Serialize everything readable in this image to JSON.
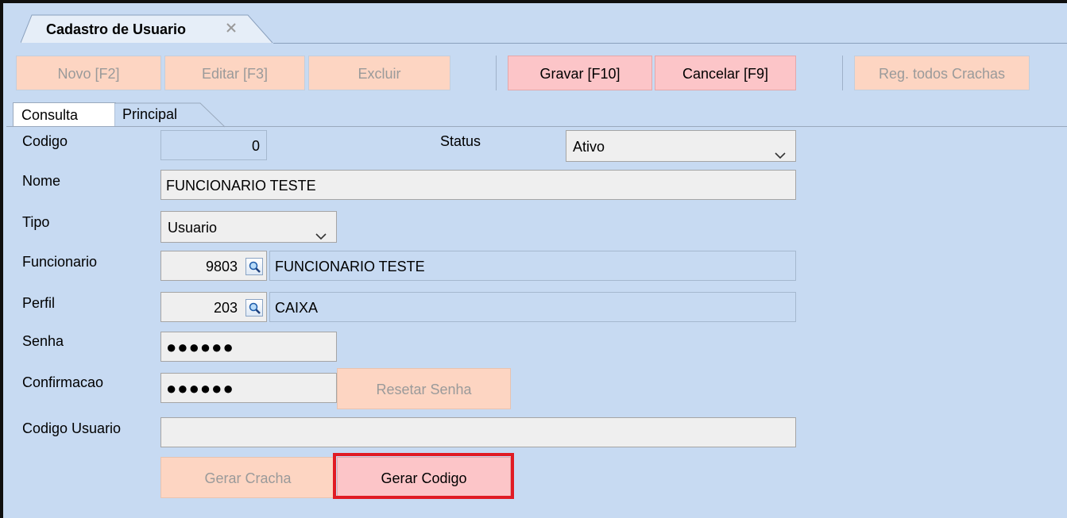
{
  "window": {
    "tab_title": "Cadastro de Usuario"
  },
  "toolbar": {
    "novo": "Novo [F2]",
    "editar": "Editar [F3]",
    "excluir": "Excluir",
    "gravar": "Gravar [F10]",
    "cancelar": "Cancelar [F9]",
    "reg_crachas": "Reg. todos Crachas"
  },
  "tabs": {
    "consulta": "Consulta",
    "principal": "Principal"
  },
  "form": {
    "codigo": {
      "label": "Codigo",
      "value": "0"
    },
    "status": {
      "label": "Status",
      "value": "Ativo"
    },
    "nome": {
      "label": "Nome",
      "value": "FUNCIONARIO TESTE"
    },
    "tipo": {
      "label": "Tipo",
      "value": "Usuario"
    },
    "funcionario": {
      "label": "Funcionario",
      "code": "9803",
      "name": "FUNCIONARIO TESTE"
    },
    "perfil": {
      "label": "Perfil",
      "code": "203",
      "name": "CAIXA"
    },
    "senha": {
      "label": "Senha",
      "value": "●●●●●●"
    },
    "confirmacao": {
      "label": "Confirmacao",
      "value": "●●●●●●"
    },
    "resetar_senha": "Resetar Senha",
    "codigo_usuario": {
      "label": "Codigo Usuario",
      "value": ""
    },
    "gerar_cracha": "Gerar Cracha",
    "gerar_codigo": "Gerar Codigo"
  },
  "colors": {
    "background": "#c7daf2",
    "disabled_button": "#fdd5c2",
    "active_button": "#fcc5c8",
    "highlight": "#e01b24"
  },
  "icons": {
    "tab_close": "close-icon",
    "lookup": "magnifier-icon",
    "combo": "chevron-down-icon"
  }
}
